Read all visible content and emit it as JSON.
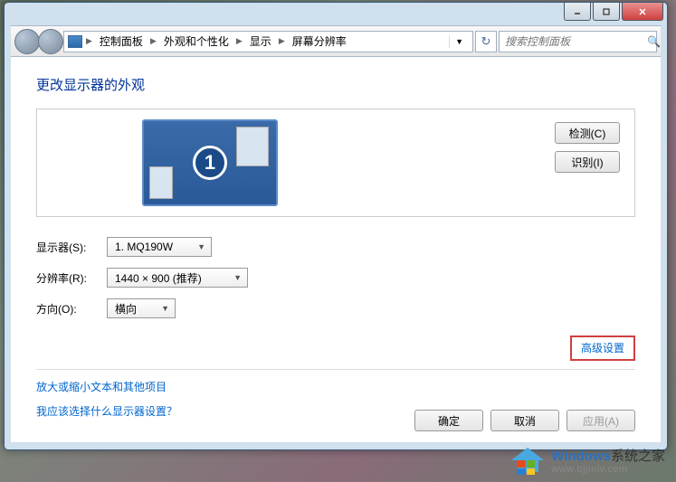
{
  "breadcrumb": {
    "items": [
      "控制面板",
      "外观和个性化",
      "显示",
      "屏幕分辨率"
    ]
  },
  "search": {
    "placeholder": "搜索控制面板"
  },
  "page": {
    "title": "更改显示器的外观"
  },
  "monitor": {
    "number": "1"
  },
  "side_buttons": {
    "detect": "检测(C)",
    "identify": "识别(I)"
  },
  "form": {
    "display_label": "显示器(S):",
    "display_value": "1. MQ190W",
    "resolution_label": "分辨率(R):",
    "resolution_value": "1440 × 900 (推荐)",
    "orientation_label": "方向(O):",
    "orientation_value": "横向"
  },
  "links": {
    "advanced": "高级设置",
    "resize_text": "放大或缩小文本和其他项目",
    "which_settings": "我应该选择什么显示器设置？"
  },
  "buttons": {
    "ok": "确定",
    "cancel": "取消",
    "apply": "应用(A)"
  },
  "watermark": {
    "brand": "Windows",
    "suffix": "系统之家",
    "url": "www.bjjmlv.com"
  }
}
